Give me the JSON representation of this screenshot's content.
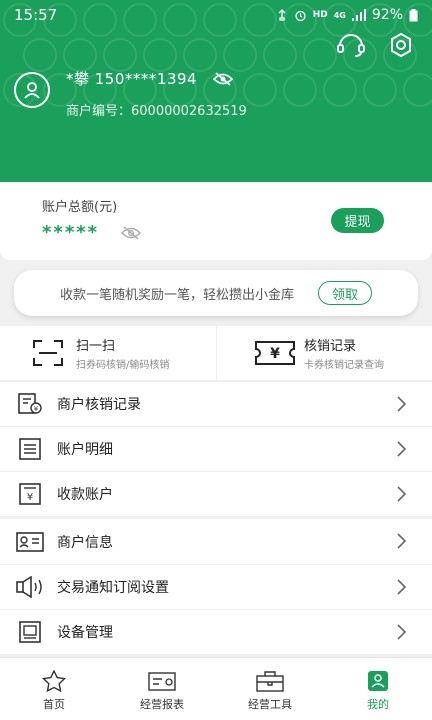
{
  "status_bar": {
    "time": "15:57",
    "network": "HD",
    "signal": "4G",
    "battery": "92%"
  },
  "user": {
    "name_masked": "*攀 150****1394",
    "merchant_label": "商户编号：",
    "merchant_no": "60000002632519"
  },
  "balance": {
    "label": "账户总额(元)",
    "value_masked": "*****",
    "withdraw_label": "提现"
  },
  "promo": {
    "text": "收款一笔随机奖励一笔，轻松攒出小金库",
    "button_label": "领取"
  },
  "quick_actions": [
    {
      "title": "扫一扫",
      "subtitle": "扫券码核销/输码核销",
      "icon": "scan-icon"
    },
    {
      "title": "核销记录",
      "subtitle": "卡券核销记录查询",
      "icon": "ticket-icon"
    }
  ],
  "menu_group_1": [
    {
      "label": "商户核销记录",
      "icon": "verify-record-icon"
    },
    {
      "label": "账户明细",
      "icon": "account-detail-icon"
    },
    {
      "label": "收款账户",
      "icon": "receive-account-icon"
    }
  ],
  "menu_group_2": [
    {
      "label": "商户信息",
      "icon": "merchant-info-icon"
    },
    {
      "label": "交易通知订阅设置",
      "icon": "notification-icon"
    },
    {
      "label": "设备管理",
      "icon": "device-icon"
    }
  ],
  "tabbar": [
    {
      "label": "首页",
      "icon": "star-icon"
    },
    {
      "label": "经营报表",
      "icon": "report-icon"
    },
    {
      "label": "经营工具",
      "icon": "toolbox-icon"
    },
    {
      "label": "我的",
      "icon": "profile-icon",
      "active": true
    }
  ],
  "colors": {
    "brand": "#1aa05a",
    "background": "#f0f0f0"
  }
}
